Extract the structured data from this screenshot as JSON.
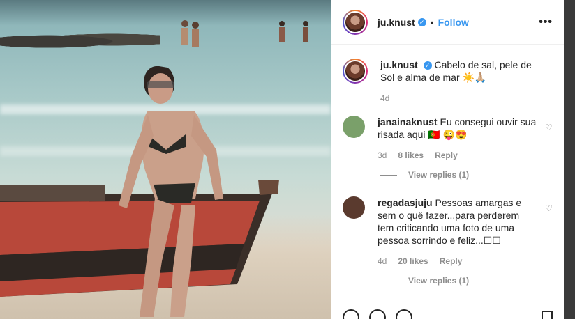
{
  "post": {
    "username": "ju.knust",
    "follow_label": "Follow",
    "more_label": "•••",
    "dot": "•",
    "verified_mark": "✓"
  },
  "caption": {
    "username": "ju.knust",
    "text": "Cabelo de sal, pele de Sol e alma de mar ☀️🙏🏼",
    "time": "4d"
  },
  "comments": [
    {
      "username": "janainaknust",
      "text": "Eu consegui ouvir sua risada aqui 🇵🇹 😜😍",
      "time": "3d",
      "likes": "8 likes",
      "reply_label": "Reply",
      "view_replies": "View replies (1)",
      "avatar_color": "#7aa06a"
    },
    {
      "username": "regadasjuju",
      "text": "Pessoas amargas e sem o quê fazer...para perderem tem criticando uma foto de uma pessoa sorrindo e feliz...☐☐",
      "time": "4d",
      "likes": "20 likes",
      "reply_label": "Reply",
      "view_replies": "View replies (1)",
      "avatar_color": "#5a3a2e"
    }
  ],
  "colors": {
    "accent": "#3897f0",
    "text": "#262626",
    "muted": "#8e8e8e"
  },
  "icons": [
    "heart-icon",
    "comment-icon",
    "share-icon",
    "bookmark-icon",
    "more-icon",
    "verified-icon"
  ]
}
